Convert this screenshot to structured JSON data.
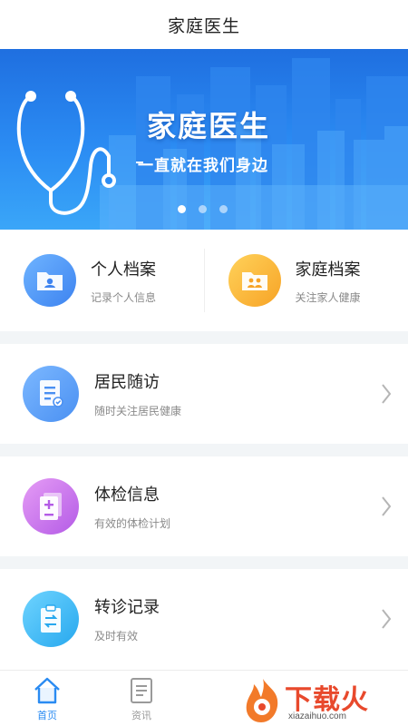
{
  "header": {
    "title": "家庭医生"
  },
  "banner": {
    "title": "家庭医生",
    "subtitle": "一直就在我们身边",
    "slide_count": 3,
    "active_slide": 0
  },
  "records": [
    {
      "title": "个人档案",
      "subtitle": "记录个人信息",
      "icon": "person-folder-icon",
      "color": "#3d83f0"
    },
    {
      "title": "家庭档案",
      "subtitle": "关注家人健康",
      "icon": "family-folder-icon",
      "color": "#f7a326"
    }
  ],
  "services": [
    {
      "title": "居民随访",
      "subtitle": "随时关注居民健康",
      "icon": "followup-document-icon",
      "color": "#4a90f2"
    },
    {
      "title": "体检信息",
      "subtitle": "有效的体检计划",
      "icon": "checkup-document-icon",
      "color": "#b45be6"
    },
    {
      "title": "转诊记录",
      "subtitle": "及时有效",
      "icon": "referral-clipboard-icon",
      "color": "#27a8ee"
    }
  ],
  "tabbar": {
    "items": [
      {
        "label": "首页",
        "icon": "home-icon",
        "active": true
      },
      {
        "label": "资讯",
        "icon": "news-icon",
        "active": false
      }
    ]
  },
  "watermark": {
    "text": "下载火",
    "url": "xiazaihuo.com"
  },
  "colors": {
    "accent": "#2a8bf2",
    "watermark": "#e8492c"
  }
}
